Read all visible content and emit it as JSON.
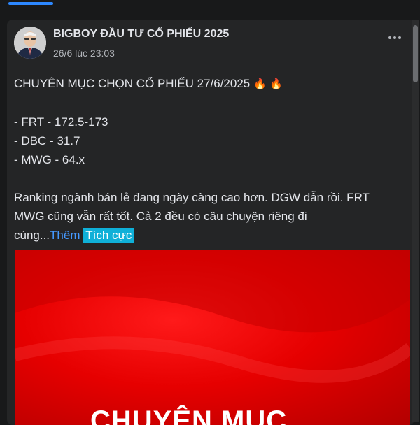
{
  "post": {
    "author": "BIGBOY ĐẦU TƯ CỔ PHIẾU 2025",
    "time": "26/6 lúc 23:03",
    "more_icon": "more-dots-icon",
    "title_line": "CHUYÊN MỤC CHỌN CỔ PHIẾU 27/6/2025",
    "flame_1": "🔥",
    "flame_2": "🔥",
    "lines": [
      "- FRT - 172.5-173",
      "- DBC - 31.7",
      "- MWG - 64.x"
    ],
    "paragraph_line_1": "Ranking ngành bán lẻ đang ngày càng cao hơn. DGW dẫn rồi. FRT",
    "paragraph_line_2": "MWG cũng vẫn rất tốt. Cả 2 đều có câu chuyện riêng đi",
    "paragraph_line_3": "cùng...",
    "see_more": "Thêm",
    "sentiment_tag": "Tích cực",
    "image_caption": "CHUYÊN MỤC"
  },
  "colors": {
    "background": "#18191a",
    "card": "#242526",
    "link": "#4599ff",
    "tag": "#0fb0d8",
    "image_red": "#e60000"
  }
}
